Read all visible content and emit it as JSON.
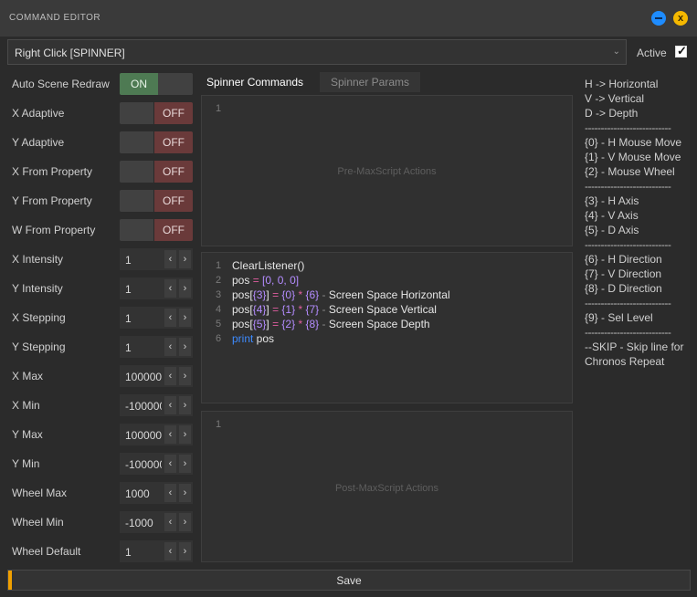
{
  "window": {
    "title": "COMMAND EDITOR"
  },
  "command_select": {
    "value": "Right Click [SPINNER]"
  },
  "active": {
    "label": "Active",
    "checked": true
  },
  "settings": [
    {
      "label": "Auto Scene Redraw",
      "type": "toggle",
      "state": "ON"
    },
    {
      "label": "X Adaptive",
      "type": "toggle",
      "state": "OFF"
    },
    {
      "label": "Y Adaptive",
      "type": "toggle",
      "state": "OFF"
    },
    {
      "label": "X From Property",
      "type": "toggle",
      "state": "OFF"
    },
    {
      "label": "Y From Property",
      "type": "toggle",
      "state": "OFF"
    },
    {
      "label": "W From Property",
      "type": "toggle",
      "state": "OFF"
    },
    {
      "label": "X Intensity",
      "type": "spinner",
      "value": "1"
    },
    {
      "label": "Y Intensity",
      "type": "spinner",
      "value": "1"
    },
    {
      "label": "X Stepping",
      "type": "spinner",
      "value": "1"
    },
    {
      "label": "Y Stepping",
      "type": "spinner",
      "value": "1"
    },
    {
      "label": "X Max",
      "type": "spinner",
      "value": "100000"
    },
    {
      "label": "X Min",
      "type": "spinner",
      "value": "-100000"
    },
    {
      "label": "Y Max",
      "type": "spinner",
      "value": "100000"
    },
    {
      "label": "Y Min",
      "type": "spinner",
      "value": "-100000"
    },
    {
      "label": "Wheel Max",
      "type": "spinner",
      "value": "1000"
    },
    {
      "label": "Wheel Min",
      "type": "spinner",
      "value": "-1000"
    },
    {
      "label": "Wheel Default",
      "type": "spinner",
      "value": "1"
    }
  ],
  "tabs": [
    {
      "label": "Spinner Commands",
      "active": true
    },
    {
      "label": "Spinner Params",
      "active": false
    }
  ],
  "pre_editor": {
    "line_numbers": [
      "1"
    ],
    "placeholder": "Pre-MaxScript Actions"
  },
  "main_editor": {
    "line_numbers": [
      "1",
      "2",
      "3",
      "4",
      "5",
      "6"
    ],
    "lines": [
      "ClearListener()",
      "pos = [0, 0, 0]",
      "pos[{3}] = {0} * {6} - Screen Space Horizontal",
      "pos[{4}] = {1} * {7} - Screen Space Vertical",
      "pos[{5}] = {2} * {8} - Screen Space Depth",
      "print pos"
    ]
  },
  "post_editor": {
    "line_numbers": [
      "1"
    ],
    "placeholder": "Post-MaxScript Actions"
  },
  "help_lines": [
    "H -> Horizontal",
    "V -> Vertical",
    "D -> Depth",
    "---------------------------",
    "{0} - H Mouse Move",
    "{1} - V Mouse Move",
    "{2} - Mouse Wheel",
    "---------------------------",
    "{3} - H Axis",
    "{4} - V Axis",
    "{5} - D Axis",
    "---------------------------",
    "{6} - H Direction",
    "{7} - V Direction",
    "{8} - D Direction",
    "---------------------------",
    "{9} - Sel Level",
    "---------------------------",
    "--SKIP - Skip line for",
    "Chronos Repeat"
  ],
  "save": {
    "label": "Save"
  },
  "colors": {
    "accent": "#f0a000",
    "on": "#4e7a53",
    "off": "#6a3a3a",
    "keyword": "#3d8bff",
    "operator": "#e05ea0",
    "number": "#b48cff"
  }
}
